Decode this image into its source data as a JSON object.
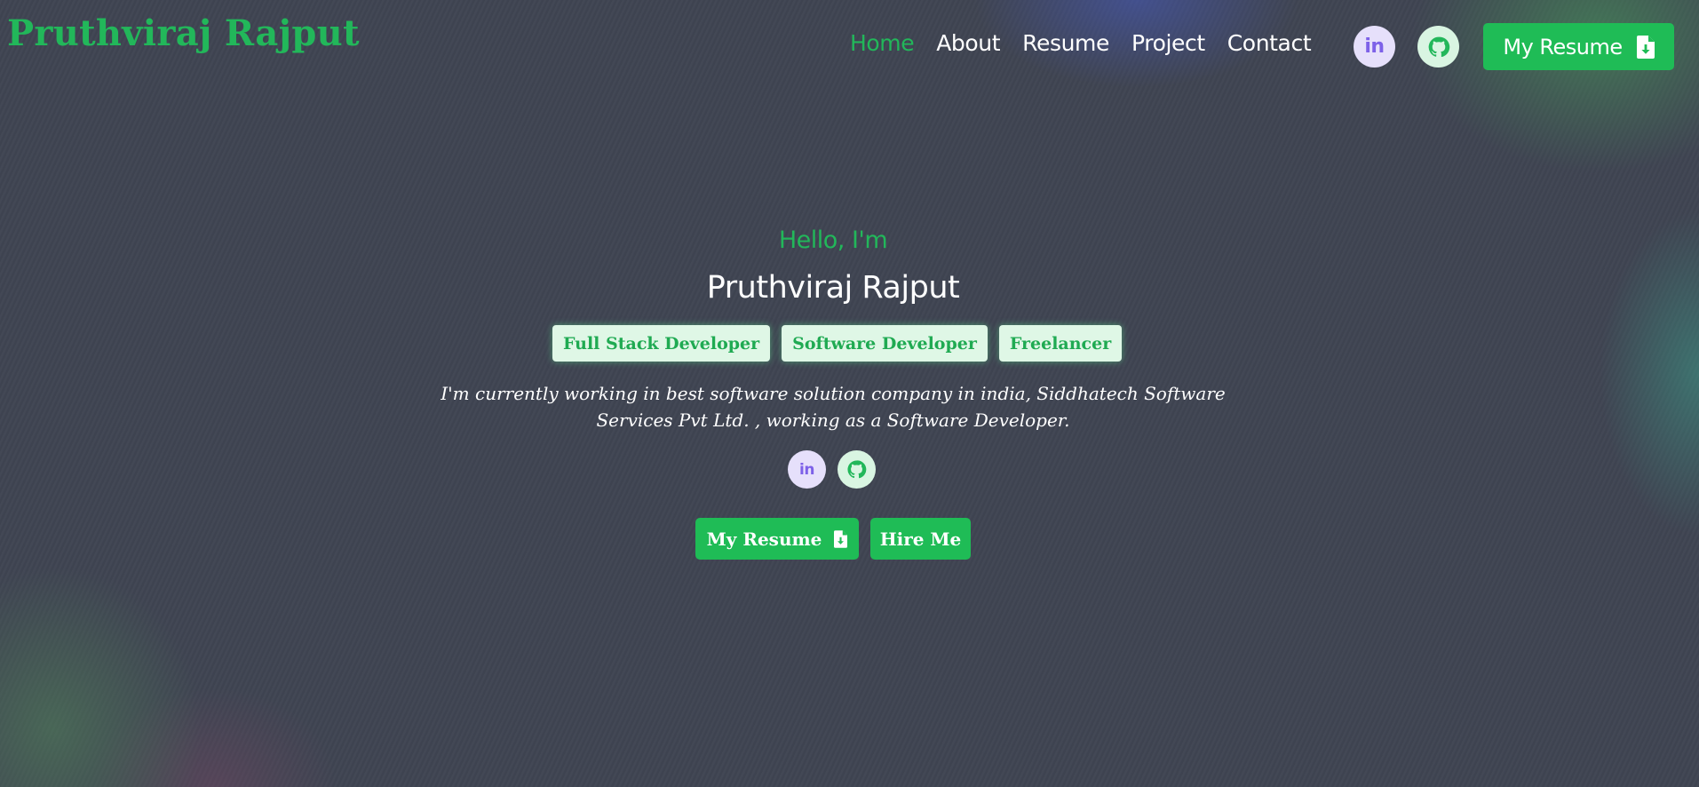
{
  "header": {
    "logo": "Pruthviraj Rajput",
    "nav": {
      "home": "Home",
      "about": "About",
      "resume": "Resume",
      "project": "Project",
      "contact": "Contact"
    },
    "social": {
      "linkedin_icon": "linkedin-icon",
      "linkedin_text": "in",
      "github_icon": "github-icon"
    },
    "resume_button": "My Resume",
    "resume_button_icon": "file-download-icon"
  },
  "hero": {
    "greeting": "Hello, I'm",
    "name": "Pruthviraj Rajput",
    "roles": [
      "Full Stack Developer",
      "Software Developer",
      "Freelancer"
    ],
    "bio_line1": "I'm currently working in best software solution company in india, Siddhatech Software",
    "bio_line2": "Services Pvt Ltd. , working as a Software Developer.",
    "linkedin_text": "in",
    "resume_button": "My Resume",
    "hire_button": "Hire Me"
  },
  "colors": {
    "accent_green": "#1fbc56",
    "background": "#3f4452",
    "linkedin_purple": "#7d61e8",
    "linkedin_bg": "#e6e0fb",
    "github_bg": "#d9f5e2"
  }
}
